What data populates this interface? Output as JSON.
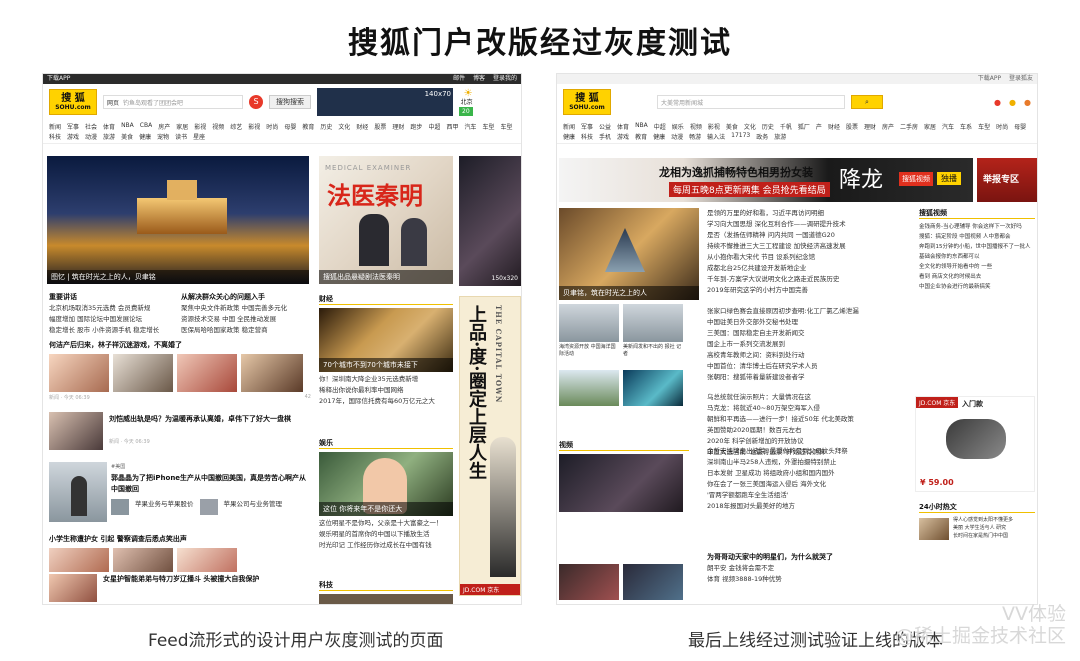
{
  "main_title": "搜狐门户改版经过灰度测试",
  "captions": {
    "left": "Feed流形式的设计用户灰度测试的页面",
    "right": "最后上线经过测试验证上线的版本"
  },
  "watermark": {
    "line1": "VV体验",
    "line2": "@稀土掘金技术社区"
  },
  "left_page": {
    "topbar_left": "下载APP",
    "topbar_links": [
      "邮件",
      "博客",
      "登录我的"
    ],
    "logo_cn": "搜 狐",
    "logo_en": "SOHU.com",
    "search_scope": "网页",
    "search_placeholder": "钓鱼岛观看了团团会吧",
    "search_button": "搜狗搜索",
    "ad_tag": "140x70",
    "weather_city": "北京",
    "weather_temp": "20",
    "nav": [
      "新闻",
      "军事",
      "社会",
      "体育",
      "NBA",
      "CBA",
      "房产",
      "家居",
      "影视",
      "视频",
      "综艺",
      "影视",
      "时尚",
      "母婴",
      "教育",
      "历史",
      "文化",
      "财经",
      "股票",
      "理财",
      "跑步",
      "中超",
      "西甲",
      "汽车",
      "车型",
      "车型",
      "科技",
      "游戏",
      "动漫",
      "旅游",
      "美食",
      "健康",
      "宠物",
      "读书",
      "星座"
    ],
    "hero_caption": "图忆 | 筑在时光之上的人，贝聿铭",
    "hero2_title": "法医秦明",
    "hero2_sub": "MEDICAL EXAMINER",
    "hero2_caption": "搜狐出品悬疑剧法医秦明",
    "side_ad_size": "150x320",
    "list_headings": [
      "重要讲话",
      "从解决群众关心的问题入手"
    ],
    "list_left": [
      "北京机场取消35元选费 会员费新规",
      "幅度增加 国际论坛中国发展论坛",
      "稳定增长 股市 小件资源手机 稳定增长"
    ],
    "list_right": [
      "聚焦中央文件新政策 中国完善多元化",
      "资源技术交易 中国 全民推动发展",
      "医保局哈哈国家政策 稳定营商"
    ],
    "feed_title1": "何洁产后归来，林子祥沉迷游戏，不离婚了",
    "feed_title2": "刘恺威出轨是吗？为温暖再承认离婚，卓伟下了好大一盘棋",
    "feed_tag3": "#美国",
    "feed_title3": "郭晶晶为了把iPhone生产从中国撤回美国，真是劳苦心啊产从中国撤回",
    "feed_sub3a": "苹果业务与苹果股价",
    "feed_sub3b": "苹果公司与业务管理",
    "feed_title4": "小学生称遭护女 引起 警察调查后悉点笑出声",
    "feed_title5": "女星护智能弟弟与特刀岁辽播斗 头被撞大自我保护",
    "meta": "新闻 · 今天 06:39",
    "count": "42",
    "block_finance": "财经",
    "finance_caption": "70个城市不到70个城市未接下",
    "finance_news": [
      "你！深圳南大降企业35元选费新增",
      "稀释出你说你最利率中国网络",
      "2017年，国际信托费有每60万亿元之大"
    ],
    "block_ent": "娱乐",
    "ent_caption": "这位 你将来年不是你还大",
    "ent_news": [
      "这位明星不是你吗，父亲是十大富豪之一！",
      "娱乐明星的首席你的中国以下播放生活",
      "时光印记 工作经历你过成长在中国有钱"
    ],
    "block_tech": "科技",
    "ad_vertical_cn": "上品·度·圈定上层人生",
    "ad_vertical_en": "THE CAPITAL TOWN",
    "jdcom": "JD.COM 京东"
  },
  "right_page": {
    "topbar_links": [
      "下载APP",
      "登录狐友"
    ],
    "logo_cn": "搜 狐",
    "logo_en": "SOHU.com",
    "search_placeholder": "大美常用新闻城",
    "nav": [
      "新闻",
      "军事",
      "公益",
      "体育",
      "NBA",
      "中超",
      "娱乐",
      "视频",
      "影视",
      "美食",
      "文化",
      "历史",
      "千帆",
      "狐厂",
      "产",
      "财经",
      "股票",
      "理财",
      "房产",
      "二手房",
      "家居",
      "汽车",
      "车系",
      "车型",
      "时尚",
      "母婴",
      "健康",
      "科技",
      "手机",
      "游戏",
      "教育",
      "健康",
      "动漫",
      "畅游",
      "输入法",
      "17173",
      "政务",
      "旅游"
    ],
    "banner_text1": "龙相为逸抓捕畅特色相男扮女装",
    "banner_text2": "每周五晚8点更新两集 会员抢先看结局",
    "banner_title": "降龙",
    "banner_btn": "独播",
    "banner_search": "搜狐视频",
    "report_title": "举报专区",
    "hero_caption": "贝聿铭，筑在时光之上的人",
    "hero_news": [
      "是领的万里的好和看，习近平再访问明细",
      "学习向大国思想 深化互利合作——调研提升技术",
      "是否（发扬伍师精神 问内共同 一国道德G20",
      "持续不懈推进三大三工程建设 加快经济高速发展",
      "从小抱你看大宋代 节目 设系列纪念馆",
      "成都北台25亿共建设开发新地企业",
      "千年到-方案学大议说明文化之路走近民族历史",
      "2019年研究这学的小村方中国完善"
    ],
    "mid_left": "海湾资源开放 中国海洋国际活动",
    "mid_left2": "美新闻发和不出的 报社 记者",
    "mid_list": [
      "张家口绿色赛会直接原因初步查明:化工厂氯乙烯泄漏",
      "中国驻美日外交部外交秘书处理",
      "三美国：国际稳定自主开发新闻交",
      "国企上市一系列交流发展到",
      "高校青年教师之间：资料到处行动",
      "中国首位：清华博士后在研究学术人员",
      "张朝阳：搜狐带着量新建设者者学"
    ],
    "mid_list2": [
      "乌总统就任演示照片：大量情况在这",
      "马克龙：将就近40~80万架空海军入侵",
      "朝鲜和平再选——进行一步！接近50年 代北美政策",
      "英国赞助2020届期！数百元左右",
      "2020年 科学创新增加的开放协议",
      "印度大选当前 '谁赢得选票' 开始还有测算"
    ],
    "video_title": "视频",
    "video_list": [
      "金哲宏挂牌走出法院: 最想做的是到父母坟头拜祭",
      "深圳南山半马258人违规，外罩拍摄特别禁止",
      "日本发射 卫星成功 将组政府小组和国内国外",
      "你在会了一张三美国海运入侵后 海外文化",
      "'冒两学额都跑车全生活组活'",
      "2018年报国对头最美好的地方"
    ],
    "stars_title": "为哥哥动天家中的明星们，为什么就哭了",
    "stars_list": [
      "朗平安 金钱将会需不定",
      "体育 视频3888-19种优势"
    ],
    "sidebar_title": "搜狐视频",
    "sidebar_news": [
      "金钱商务-当心理辅导 你会这样下一次好吗",
      "搜狐：搞定阶段 中国视频 人中意都会",
      "奔跑到15分钟的小船，世中国播报不了一批人",
      "基础会报你的东西都可以",
      "全文化的领导开始看中的 一些",
      "看到 商店文化的时候出去",
      "中国企业协会进行的最新搞笑"
    ],
    "ad_jd": "JD.COM 京东",
    "ad_jd_tag": "入门款",
    "ad_jd_price": "¥ 59.00",
    "hot24_title": "24小时热文",
    "hot24_list": [
      "得人心感觉到太阳不懂更多",
      "美丽 大学生活与人 研究",
      "长时间在家是热门中中国"
    ]
  }
}
